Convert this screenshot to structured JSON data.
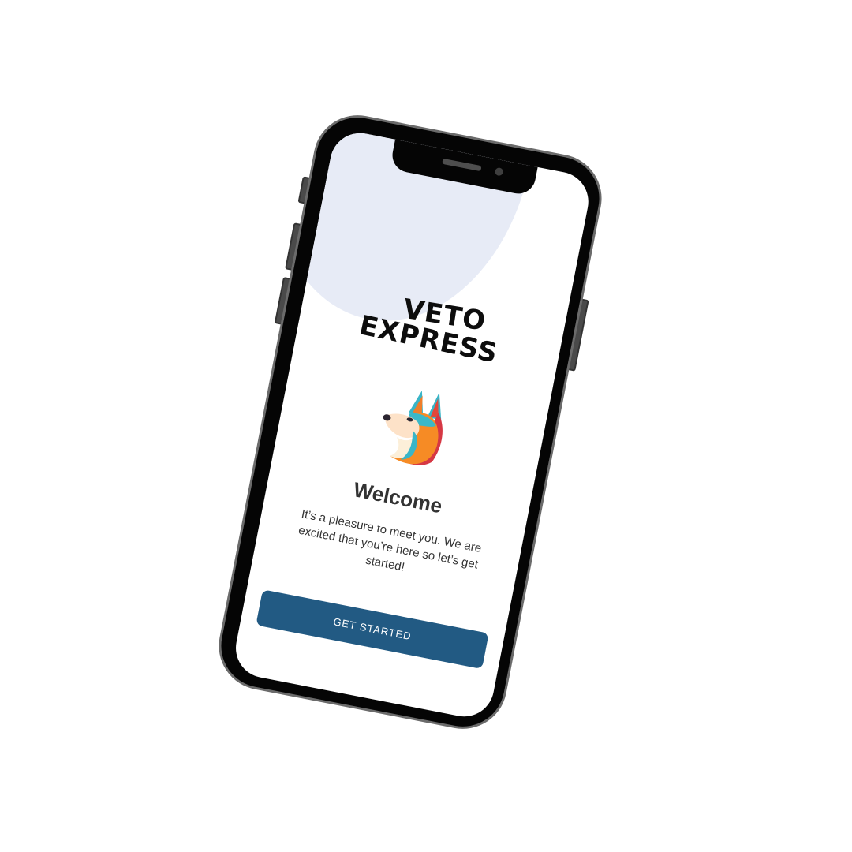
{
  "app": {
    "brand_line_1": "VETO",
    "brand_line_2": "EXPRESS"
  },
  "onboarding": {
    "title": "Welcome",
    "message": "It’s a pleasure to meet you. We are excited that you’re here so let’s get started!",
    "primary_button_label": "GET STARTED"
  },
  "logo": {
    "icon": "fox-head-icon"
  },
  "colors": {
    "background": "#ffffff",
    "accent_circle": "#e7ebf6",
    "primary_button": "#225a83",
    "text": "#333333",
    "phone_frame": "#050505"
  }
}
